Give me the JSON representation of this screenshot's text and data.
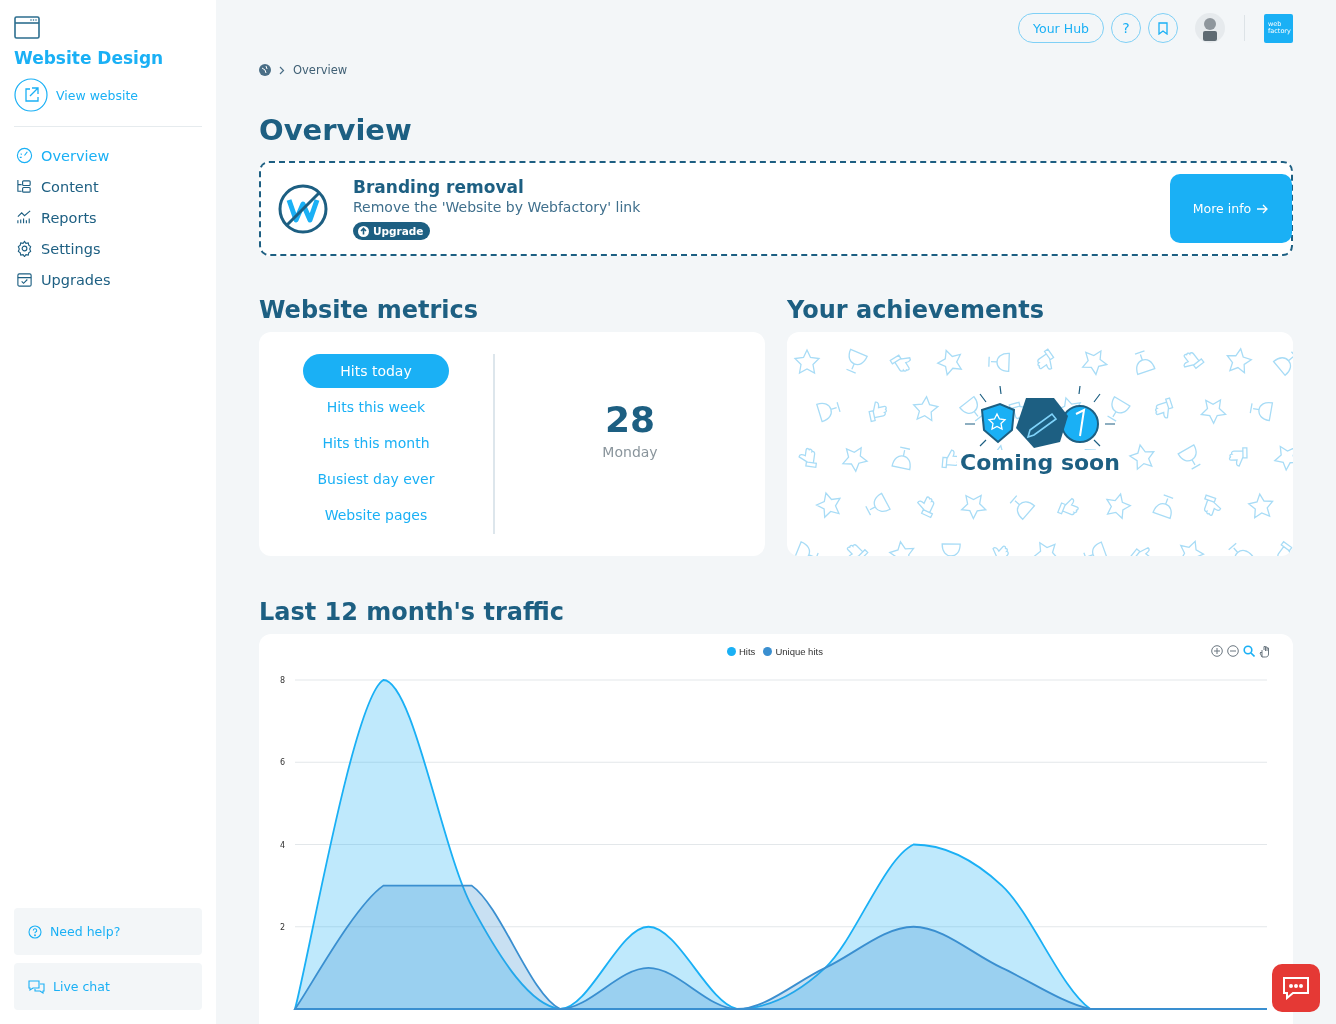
{
  "sidebar": {
    "site_title": "Website Design",
    "view_link": "View website",
    "items": [
      {
        "label": "Overview",
        "selected": true
      },
      {
        "label": "Content",
        "selected": false
      },
      {
        "label": "Reports",
        "selected": false
      },
      {
        "label": "Settings",
        "selected": false
      },
      {
        "label": "Upgrades",
        "selected": false
      }
    ],
    "help_buttons": [
      {
        "label": "Need help?"
      },
      {
        "label": "Live chat"
      }
    ]
  },
  "topbar": {
    "hub_button": "Your Hub",
    "help_button": "?",
    "logo_text": "web factory"
  },
  "breadcrumb": [
    "Overview"
  ],
  "page_title": "Overview",
  "promo": {
    "title": "Branding removal",
    "text": "Remove the 'Website by Webfactory' link",
    "badge": "Upgrade",
    "button": "More info"
  },
  "metrics": {
    "title": "Website metrics",
    "tabs": [
      {
        "label": "Hits today",
        "selected": true
      },
      {
        "label": "Hits this week",
        "selected": false
      },
      {
        "label": "Hits this month",
        "selected": false
      },
      {
        "label": "Busiest day ever",
        "selected": false
      },
      {
        "label": "Website pages",
        "selected": false
      }
    ],
    "value": "28",
    "caption": "Monday"
  },
  "achievements": {
    "title": "Your achievements",
    "status": "Coming soon"
  },
  "traffic": {
    "title": "Last 12 month's traffic",
    "chart_data": {
      "type": "area",
      "grid": true,
      "ylim": [
        0,
        8
      ],
      "yticks": [
        2,
        4,
        6,
        8
      ],
      "series": [
        {
          "name": "Hits",
          "color": "#1ab0f5",
          "values": [
            0,
            8,
            2.5,
            0,
            2,
            0,
            1,
            4,
            3,
            0,
            0,
            0
          ]
        },
        {
          "name": "Unique hits",
          "color": "#3a8fd0",
          "values": [
            0,
            3,
            3,
            0,
            1,
            0,
            1,
            2,
            1,
            0,
            0,
            0
          ]
        }
      ]
    }
  }
}
